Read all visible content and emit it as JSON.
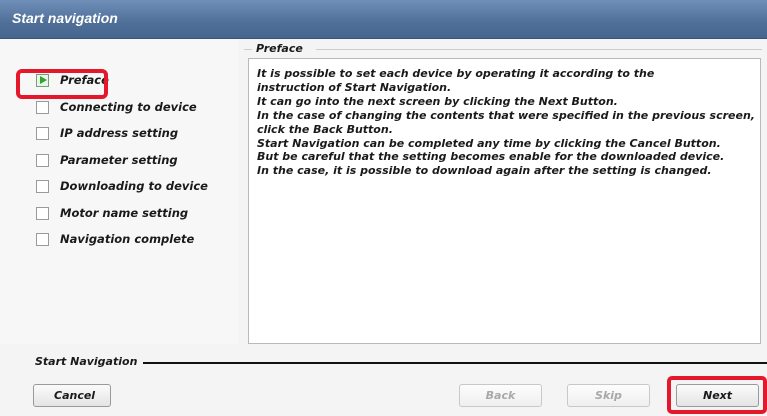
{
  "window": {
    "title": "Start navigation"
  },
  "sidebar": {
    "items": [
      {
        "label": "Preface",
        "active": true
      },
      {
        "label": "Connecting to device",
        "active": false
      },
      {
        "label": "IP address setting",
        "active": false
      },
      {
        "label": "Parameter setting",
        "active": false
      },
      {
        "label": "Downloading to device",
        "active": false
      },
      {
        "label": "Motor name setting",
        "active": false
      },
      {
        "label": "Navigation complete",
        "active": false
      }
    ]
  },
  "main": {
    "group_title": "Preface",
    "lines": [
      "It is possible to set each device by operating it according to the",
      "instruction of Start Navigation.",
      "It can go into the next screen by clicking the Next Button.",
      "In the case of changing the contents that were specified in the previous screen,",
      "click the Back Button.",
      "Start Navigation can be completed any time by clicking the Cancel Button.",
      "But be careful that the setting becomes enable for the downloaded device.",
      "In the case, it is possible to download again after the setting is changed."
    ]
  },
  "footer": {
    "label": "Start Navigation",
    "buttons": {
      "cancel": "Cancel",
      "back": "Back",
      "skip": "Skip",
      "next": "Next"
    }
  },
  "colors": {
    "titlebar": "#4f6f98",
    "highlight": "#e5182b",
    "active_marker": "#2ea52e"
  }
}
